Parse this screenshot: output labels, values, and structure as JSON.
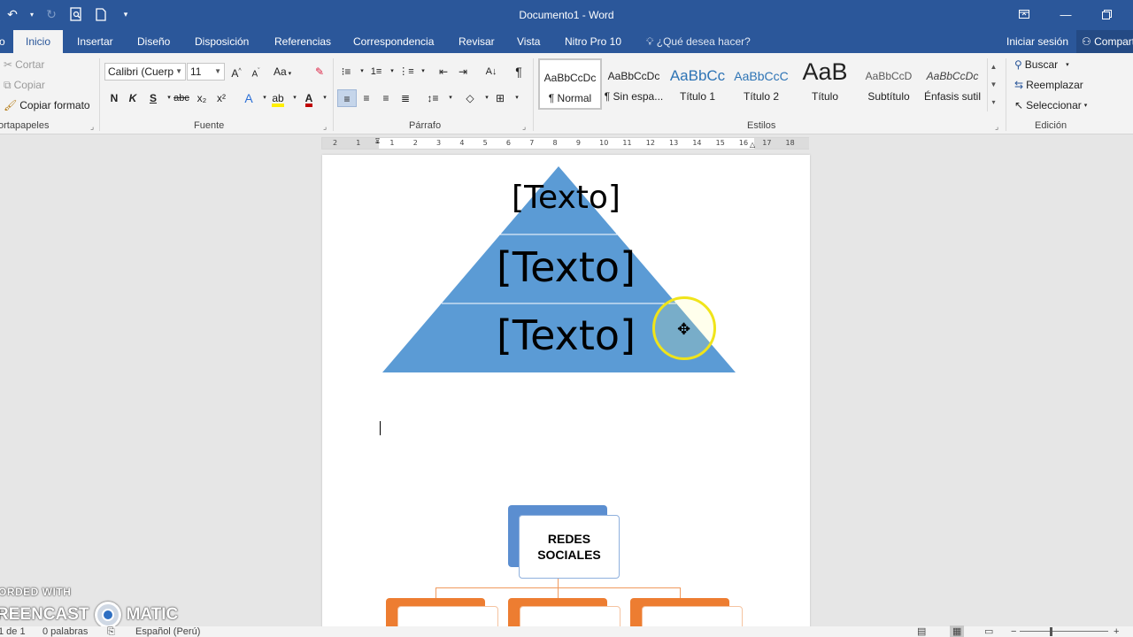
{
  "window": {
    "title": "Documento1 - Word",
    "accent": "#2b579a"
  },
  "tabs": [
    {
      "label": "o"
    },
    {
      "label": "Inicio"
    },
    {
      "label": "Insertar"
    },
    {
      "label": "Diseño"
    },
    {
      "label": "Disposición"
    },
    {
      "label": "Referencias"
    },
    {
      "label": "Correspondencia"
    },
    {
      "label": "Revisar"
    },
    {
      "label": "Vista"
    },
    {
      "label": "Nitro Pro 10"
    }
  ],
  "tell_me": "¿Qué desea hacer?",
  "account": {
    "signin": "Iniciar sesión",
    "share": "Compartir"
  },
  "clipboard": {
    "cut": "Cortar",
    "copy": "Copiar",
    "format_painter": "Copiar formato",
    "label": "ortapapeles"
  },
  "font": {
    "name": "Calibri (Cuerpo)",
    "size": "11",
    "bold": "N",
    "italic": "K",
    "underline": "S",
    "strike": "abc",
    "subscript": "x₂",
    "superscript": "x²",
    "case": "Aa",
    "label": "Fuente"
  },
  "paragraph": {
    "label": "Párrafo"
  },
  "styles": {
    "label": "Estilos",
    "items": [
      {
        "preview": "AaBbCcDc",
        "name": "¶ Normal"
      },
      {
        "preview": "AaBbCcDc",
        "name": "¶ Sin espa..."
      },
      {
        "preview": "AaBbCc",
        "name": "Título 1"
      },
      {
        "preview": "AaBbCcC",
        "name": "Título 2"
      },
      {
        "preview": "AaB",
        "name": "Título"
      },
      {
        "preview": "AaBbCcD",
        "name": "Subtítulo"
      },
      {
        "preview": "AaBbCcDc",
        "name": "Énfasis sutil"
      }
    ]
  },
  "editing": {
    "find": "Buscar",
    "replace": "Reemplazar",
    "select": "Seleccionar",
    "label": "Edición"
  },
  "ruler_ticks": [
    "2",
    "1",
    "1",
    "2",
    "3",
    "4",
    "5",
    "6",
    "7",
    "8",
    "9",
    "10",
    "11",
    "12",
    "13",
    "14",
    "15",
    "16",
    "17",
    "18"
  ],
  "document": {
    "pyramid": {
      "levels": [
        "[Texto]",
        "[Texto]",
        "[Texto]"
      ],
      "fill": "#5b9bd5"
    },
    "org_chart": {
      "top": "REDES\nSOCIALES",
      "top_color": "#5b8ed0",
      "child_color": "#ed7d31",
      "children": 3
    }
  },
  "watermark": {
    "line1": "ORDED WITH",
    "line2_left": "REENCAST",
    "line2_right": "MATIC"
  },
  "status": {
    "page": "1 de 1",
    "words": "0 palabras",
    "language": "Español (Perú)"
  }
}
